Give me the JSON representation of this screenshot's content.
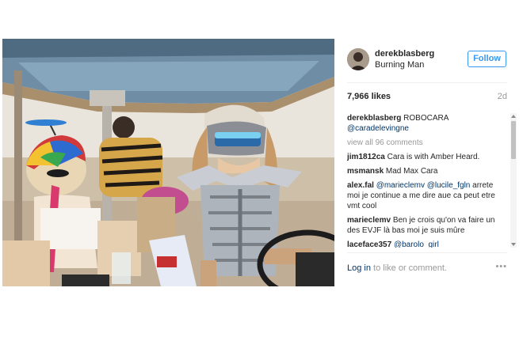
{
  "post": {
    "username": "derekblasberg",
    "location": "Burning Man",
    "follow_label": "Follow",
    "likes": "7,966 likes",
    "age": "2d",
    "caption_user": "derekblasberg",
    "caption_text": " ROBOCARA",
    "caption_mention": "@caradelevingne",
    "view_all": "view all 96 comments",
    "comments": [
      {
        "user": "jim1812ca",
        "text": " Cara is with Amber Heard.",
        "mention": ""
      },
      {
        "user": "msmansk",
        "text": " Mad Max Cara",
        "mention": ""
      },
      {
        "user": "alex.fal",
        "mention": " @marieclemv @lucile_fgln",
        "text": " arrete moi je continue a me dire aue ca peut etre vmt cool"
      },
      {
        "user": "marieclemv",
        "text": " Ben je crois qu'on va faire un des EVJF là bas moi je suis mûre",
        "mention": ""
      },
      {
        "user": "laceface357",
        "mention": " @barolo_girl",
        "text": ""
      }
    ],
    "login_link": "Log in",
    "login_rest": " to like or comment.",
    "more_icon": "•••"
  },
  "icons": {
    "avatar": "avatar-photo",
    "more": "more-options-icon"
  }
}
